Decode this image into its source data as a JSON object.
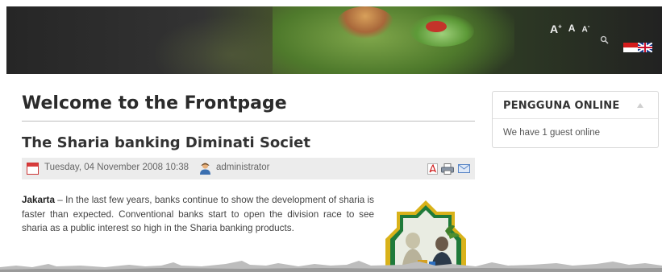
{
  "header": {
    "font_tools": {
      "increase": "A",
      "increase_sup": "+",
      "reset": "A",
      "decrease": "A",
      "decrease_sup": "-"
    },
    "icons": [
      "search-icon",
      "flag-indonesia-icon",
      "flag-uk-icon"
    ]
  },
  "main": {
    "page_title": "Welcome to the Frontpage",
    "article": {
      "title": "The Sharia banking Diminati Societ",
      "date": "Tuesday, 04 November 2008 10:38",
      "author": "administrator",
      "lead": "Jakarta",
      "body": " – In the last few years, banks continue to show the development of sharia is faster than expected. Conventional banks start to open the division race to see sharia as a public interest so high in the Sharia banking products.",
      "icons": [
        "calendar-icon",
        "user-icon",
        "pdf-icon",
        "print-icon",
        "email-icon"
      ]
    }
  },
  "sidebar": {
    "module": {
      "title": "PENGGUNA ONLINE",
      "text": "We have 1 guest online"
    }
  },
  "colors": {
    "meta_bar": "#ececec",
    "flag_red": "#d41c1c",
    "frame_gold": "#d9b21a"
  }
}
